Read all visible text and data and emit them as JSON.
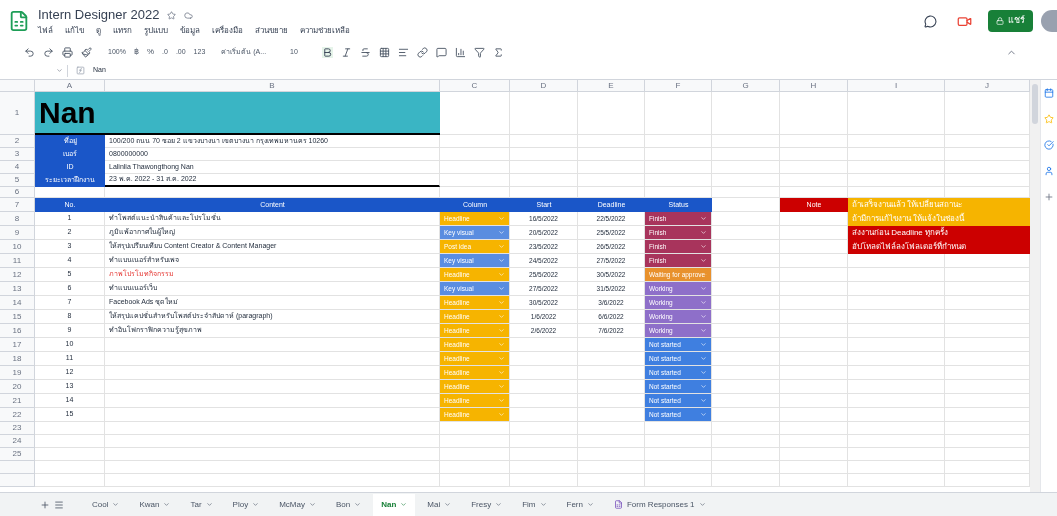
{
  "document": {
    "title": "Intern Designer 2022",
    "menu": [
      "ไฟล์",
      "แก้ไข",
      "ดู",
      "แทรก",
      "รูปแบบ",
      "ข้อมูล",
      "เครื่องมือ",
      "ส่วนขยาย",
      "ความช่วยเหลือ"
    ],
    "share_label": "แชร์"
  },
  "toolbar": {
    "zoom": "100%",
    "currency": "฿",
    "percent": "%",
    "decimals_less": ".0",
    "decimals_more": ".00",
    "number_format": "123",
    "font": "ค่าเริ่มต้น (A...",
    "font_size": "10"
  },
  "formula_bar": {
    "value": "Nan"
  },
  "columns": [
    "A",
    "B",
    "C",
    "D",
    "E",
    "F",
    "G",
    "H",
    "I",
    "J"
  ],
  "row_numbers": [
    "1",
    "2",
    "3",
    "4",
    "5",
    "6",
    "7",
    "8",
    "9",
    "10",
    "11",
    "12",
    "13",
    "14",
    "15",
    "16",
    "17",
    "18",
    "19",
    "20",
    "21",
    "22",
    "23",
    "24",
    "25"
  ],
  "name_title": "Nan",
  "info": [
    {
      "label": "ที่อยู่",
      "value": "100/200 ถนน 70 ซอย 2 แขวงบางนา เขตบางนา กรุงเทพมหานคร 10260"
    },
    {
      "label": "เบอร์",
      "value": "0800000000"
    },
    {
      "label": "ID",
      "value": "Lalinlia Thawongthong Nan"
    },
    {
      "label": "ระยะเวลาฝึกงาน",
      "value": "23 พ.ค. 2022 - 31 ส.ค. 2022"
    }
  ],
  "table": {
    "columns": [
      "No.",
      "Content",
      "Column",
      "Start",
      "Deadline",
      "Status"
    ],
    "rows": [
      {
        "no": "1",
        "content": "ทำโพสต์แนะนำสินค้าและโปรโมชั่น",
        "alert": false,
        "column": {
          "label": "Headline",
          "color": "#f6b400"
        },
        "start": "16/5/2022",
        "deadline": "22/5/2022",
        "status": {
          "label": "Finish",
          "color": "#a8345c"
        }
      },
      {
        "no": "2",
        "content": "ภูมิแพ้อากาศในผู้ใหญ่",
        "alert": false,
        "column": {
          "label": "Key visual",
          "color": "#5a8de0"
        },
        "start": "20/5/2022",
        "deadline": "25/5/2022",
        "status": {
          "label": "Finish",
          "color": "#a8345c"
        }
      },
      {
        "no": "3",
        "content": "ให้สรุปเปรียบเทียบ Content Creator & Content Manager",
        "alert": false,
        "column": {
          "label": "Post idea",
          "color": "#f6b400"
        },
        "start": "23/5/2022",
        "deadline": "26/5/2022",
        "status": {
          "label": "Finish",
          "color": "#a8345c"
        }
      },
      {
        "no": "4",
        "content": "ทำแบนเนอร์สำหรับเพจ",
        "alert": false,
        "column": {
          "label": "Key visual",
          "color": "#5a8de0"
        },
        "start": "24/5/2022",
        "deadline": "27/5/2022",
        "status": {
          "label": "Finish",
          "color": "#a8345c"
        }
      },
      {
        "no": "5",
        "content": "ภาพโปรโมทกิจกรรม",
        "alert": true,
        "column": {
          "label": "Headline",
          "color": "#f6b400"
        },
        "start": "25/5/2022",
        "deadline": "30/5/2022",
        "status": {
          "label": "Waiting for approve",
          "color": "#e8912d"
        }
      },
      {
        "no": "6",
        "content": "ทำแบนเนอร์เว็บ",
        "alert": false,
        "column": {
          "label": "Key visual",
          "color": "#5a8de0"
        },
        "start": "27/5/2022",
        "deadline": "31/5/2022",
        "status": {
          "label": "Working",
          "color": "#8e6fc9"
        }
      },
      {
        "no": "7",
        "content": "Facebook Ads ชุดใหม่",
        "alert": false,
        "column": {
          "label": "Headline",
          "color": "#f6b400"
        },
        "start": "30/5/2022",
        "deadline": "3/6/2022",
        "status": {
          "label": "Working",
          "color": "#8e6fc9"
        }
      },
      {
        "no": "8",
        "content": "ให้สรุปแคปชั่นสำหรับโพสต์ประจำสัปดาห์ (paragraph)",
        "alert": false,
        "column": {
          "label": "Headline",
          "color": "#f6b400"
        },
        "start": "1/6/2022",
        "deadline": "6/6/2022",
        "status": {
          "label": "Working",
          "color": "#8e6fc9"
        }
      },
      {
        "no": "9",
        "content": "ทำอินโฟกราฟิกความรู้สุขภาพ",
        "alert": false,
        "column": {
          "label": "Headline",
          "color": "#f6b400"
        },
        "start": "2/6/2022",
        "deadline": "7/6/2022",
        "status": {
          "label": "Working",
          "color": "#8e6fc9"
        }
      },
      {
        "no": "10",
        "column": {
          "label": "Headline",
          "color": "#f6b400"
        },
        "status": {
          "label": "Not started",
          "color": "#3f7fe0"
        }
      },
      {
        "no": "11",
        "column": {
          "label": "Headline",
          "color": "#f6b400"
        },
        "status": {
          "label": "Not started",
          "color": "#3f7fe0"
        }
      },
      {
        "no": "12",
        "column": {
          "label": "Headline",
          "color": "#f6b400"
        },
        "status": {
          "label": "Not started",
          "color": "#3f7fe0"
        }
      },
      {
        "no": "13",
        "column": {
          "label": "Headline",
          "color": "#f6b400"
        },
        "status": {
          "label": "Not started",
          "color": "#3f7fe0"
        }
      },
      {
        "no": "14",
        "column": {
          "label": "Headline",
          "color": "#f6b400"
        },
        "status": {
          "label": "Not started",
          "color": "#3f7fe0"
        }
      },
      {
        "no": "15",
        "column": {
          "label": "Headline",
          "color": "#f6b400"
        },
        "status": {
          "label": "Not started",
          "color": "#3f7fe0"
        }
      }
    ]
  },
  "note": {
    "label": "Note",
    "lines": [
      {
        "text": "ถ้าเสร็จงานแล้ว ให้เปลี่ยนสถานะ",
        "color": "#f6b400"
      },
      {
        "text": "ถ้ามีการแก้ไขงาน ให้แจ้งในช่องนี้",
        "color": "#f6b400"
      },
      {
        "text": "ส่งงานก่อน Deadline ทุกครั้ง",
        "color": "#cc0000"
      },
      {
        "text": "อัปโหลดไฟล์ลงโฟลเดอร์ที่กำหนด",
        "color": "#cc0000"
      }
    ]
  },
  "sheet_tabs": [
    {
      "label": "Cool",
      "selected": false
    },
    {
      "label": "Kwan",
      "selected": false
    },
    {
      "label": "Tar",
      "selected": false
    },
    {
      "label": "Ploy",
      "selected": false
    },
    {
      "label": "McMay",
      "selected": false
    },
    {
      "label": "Bon",
      "selected": false
    },
    {
      "label": "Nan",
      "selected": true
    },
    {
      "label": "Mai",
      "selected": false
    },
    {
      "label": "Fresy",
      "selected": false
    },
    {
      "label": "Fim",
      "selected": false
    },
    {
      "label": "Fern",
      "selected": false
    },
    {
      "label": "Form Responses 1",
      "selected": false,
      "kind": "form"
    }
  ]
}
